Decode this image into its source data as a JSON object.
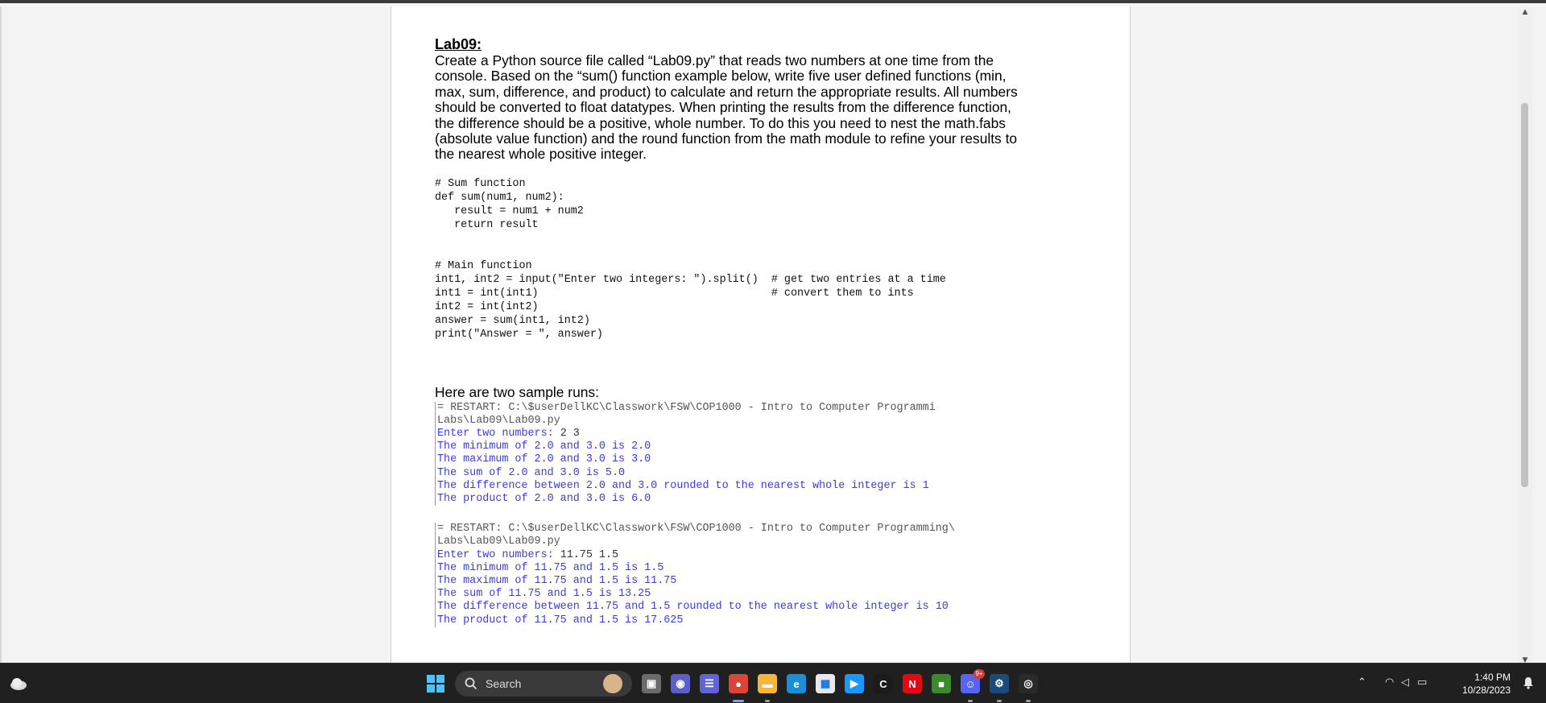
{
  "document": {
    "title": "Lab09:",
    "paragraph": [
      "Create a Python source file called “Lab09.py” that reads two numbers at one time from the",
      "console.  Based on the “sum() function example below, write five user defined functions (min,",
      "max, sum, difference, and product) to calculate and return the appropriate results.  All numbers",
      "should be converted to float datatypes. When printing the results from the difference function,",
      "the difference should be a positive, whole number. To do this you need to nest the math.fabs",
      "(absolute value function) and the round function from the math module to refine your results to",
      "the nearest whole positive integer."
    ],
    "code_sum": [
      "# Sum function",
      "def sum(num1, num2):",
      "   result = num1 + num2",
      "   return result"
    ],
    "code_main": [
      "# Main function",
      "int1, int2 = input(\"Enter two integers: \").split()  # get two entries at a time",
      "int1 = int(int1)                                    # convert them to ints",
      "int2 = int(int2)",
      "answer = sum(int1, int2)",
      "print(\"Answer = \", answer)"
    ],
    "samples_heading": "Here are two sample runs:",
    "run1": {
      "restart": "= RESTART: C:\\$userDellKC\\Classwork\\FSW\\COP1000 - Intro to Computer Programmi",
      "path": "Labs\\Lab09\\Lab09.py",
      "prompt": "Enter two numbers: ",
      "input": "2 3",
      "lines": [
        "The minimum of 2.0 and 3.0 is 2.0",
        "The maximum of 2.0 and 3.0 is 3.0",
        "The sum of 2.0 and 3.0 is 5.0",
        "The difference between 2.0 and 3.0 rounded to the nearest whole integer is 1",
        "The product of 2.0 and 3.0 is 6.0"
      ]
    },
    "run2": {
      "restart": "= RESTART: C:\\$userDellKC\\Classwork\\FSW\\COP1000 - Intro to Computer Programming\\",
      "path": "Labs\\Lab09\\Lab09.py",
      "prompt": "Enter two numbers: ",
      "input": "11.75 1.5",
      "lines": [
        "The minimum of 11.75 and 1.5 is 1.5",
        "The maximum of 11.75 and 1.5 is 11.75",
        "The sum of 11.75 and 1.5 is 13.25",
        "The difference between 11.75 and 1.5 rounded to the nearest whole integer is 10",
        "The product of 11.75 and 1.5 is 17.625"
      ]
    }
  },
  "taskbar": {
    "search_label": "Search",
    "apps": [
      {
        "name": "task-view-icon",
        "color": "#6b6b6b",
        "glyph": "▣"
      },
      {
        "name": "teams-meet-icon",
        "color": "#5b5fc7",
        "glyph": "◉"
      },
      {
        "name": "chat-icon",
        "color": "#6264d6",
        "glyph": "☰"
      },
      {
        "name": "chrome-icon",
        "color": "#db4437",
        "glyph": "●"
      },
      {
        "name": "file-explorer-icon",
        "color": "#f4b73a",
        "glyph": "▬"
      },
      {
        "name": "edge-icon",
        "color": "#1a8fd6",
        "glyph": "e"
      },
      {
        "name": "microsoft-store-icon",
        "color": "#e8e8e8",
        "glyph": "▦"
      },
      {
        "name": "prime-video-icon",
        "color": "#1a98ff",
        "glyph": "▶"
      },
      {
        "name": "codehs-icon",
        "color": "#1c1c1c",
        "glyph": "C"
      },
      {
        "name": "netflix-icon",
        "color": "#e50914",
        "glyph": "N"
      },
      {
        "name": "minecraft-icon",
        "color": "#3c8a2e",
        "glyph": "■"
      },
      {
        "name": "discord-icon",
        "color": "#5865f2",
        "glyph": "☺"
      },
      {
        "name": "steam-icon",
        "color": "#1b4b7a",
        "glyph": "⚙"
      },
      {
        "name": "obs-icon",
        "color": "#2a2a2a",
        "glyph": "◎"
      }
    ],
    "discord_badge": "9+",
    "time": "1:40 PM",
    "date": "10/28/2023"
  }
}
